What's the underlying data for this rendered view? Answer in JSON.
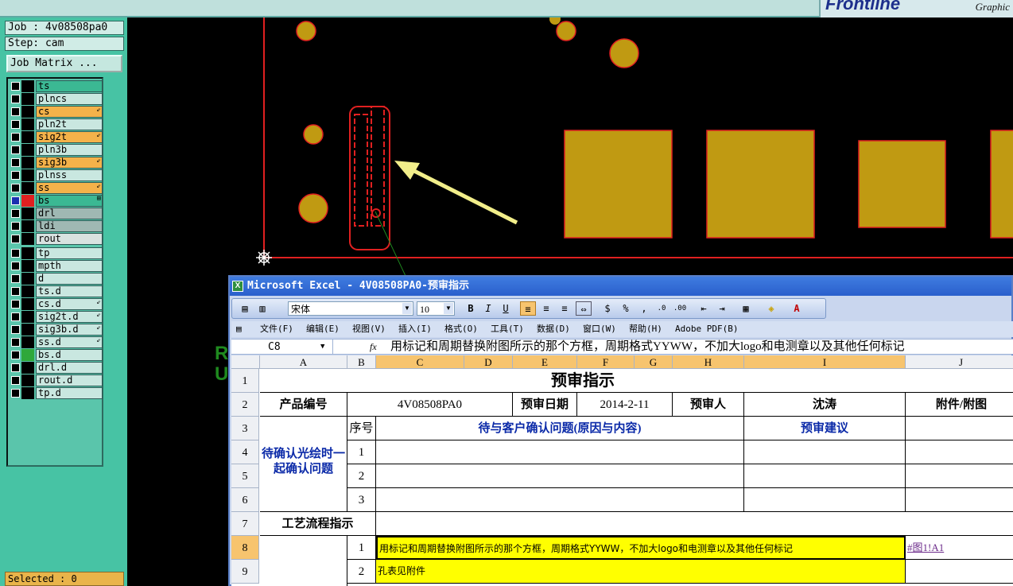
{
  "cam": {
    "job": "Job : 4v08508pa0",
    "step": "Step: cam",
    "job_matrix": "Job Matrix ...",
    "selected": "Selected : 0",
    "layers": [
      {
        "name": "ts",
        "color": "#3bb893",
        "mark": ""
      },
      {
        "name": "plncs",
        "color": "#c9e7e0",
        "mark": ""
      },
      {
        "name": "cs",
        "color": "#f4b24a",
        "mark": "⇙"
      },
      {
        "name": "pln2t",
        "color": "#c9e7e0",
        "mark": ""
      },
      {
        "name": "sig2t",
        "color": "#f4b24a",
        "mark": "⇙"
      },
      {
        "name": "pln3b",
        "color": "#c9e7e0",
        "mark": ""
      },
      {
        "name": "sig3b",
        "color": "#f4b24a",
        "mark": "⇙"
      },
      {
        "name": "plnss",
        "color": "#c9e7e0",
        "mark": ""
      },
      {
        "name": "ss",
        "color": "#f4b24a",
        "mark": "⇙"
      },
      {
        "name": "bs",
        "color": "#3bb893",
        "mark": "⊞"
      },
      {
        "name": "drl",
        "color": "#9fb8b3",
        "mark": ""
      },
      {
        "name": "ldi",
        "color": "#9fb8b3",
        "mark": ""
      },
      {
        "name": "rout",
        "color": "#d8e2e0",
        "mark": ""
      },
      {
        "name": "tp",
        "color": "#c9e7e0",
        "mark": ""
      },
      {
        "name": "mpth",
        "color": "#c9e7e0",
        "mark": ""
      },
      {
        "name": "d",
        "color": "#c9e7e0",
        "mark": ""
      },
      {
        "name": "ts.d",
        "color": "#c9e7e0",
        "mark": ""
      },
      {
        "name": "cs.d",
        "color": "#c9e7e0",
        "mark": "⇙"
      },
      {
        "name": "sig2t.d",
        "color": "#c9e7e0",
        "mark": "⇙"
      },
      {
        "name": "sig3b.d",
        "color": "#c9e7e0",
        "mark": "⇙"
      },
      {
        "name": "ss.d",
        "color": "#c9e7e0",
        "mark": "⇙"
      },
      {
        "name": "bs.d",
        "color": "#c9e7e0",
        "mark": ""
      },
      {
        "name": "drl.d",
        "color": "#c9e7e0",
        "mark": ""
      },
      {
        "name": "rout.d",
        "color": "#c9e7e0",
        "mark": ""
      },
      {
        "name": "tp.d",
        "color": "#c9e7e0",
        "mark": ""
      }
    ],
    "brand_sub": "Graphic",
    "side_letters": "R\nU"
  },
  "excel": {
    "title": "Microsoft Excel - 4V08508PA0-预审指示",
    "font_name": "宋体",
    "font_size": "10",
    "menus": [
      "文件(F)",
      "编辑(E)",
      "视图(V)",
      "插入(I)",
      "格式(O)",
      "工具(T)",
      "数据(D)",
      "窗口(W)",
      "帮助(H)",
      "Adobe PDF(B)"
    ],
    "name_box": "C8",
    "fx": "fx",
    "formula": "用标记和周期替换附图所示的那个方框，周期格式YYWW，不加大logo和电测章以及其他任何标记",
    "columns": [
      "A",
      "B",
      "C",
      "D",
      "E",
      "F",
      "G",
      "H",
      "I",
      "J"
    ],
    "rows": [
      "1",
      "2",
      "3",
      "4",
      "5",
      "6",
      "7",
      "8",
      "9"
    ],
    "cells": {
      "title": "预审指示",
      "product_label": "产品编号",
      "product_value": "4V08508PA0",
      "date_label": "预审日期",
      "date_value": "2014-2-11",
      "reviewer_label": "预审人",
      "reviewer_value": "沈涛",
      "attach_label": "附件/附图",
      "seq_label": "序号",
      "issue_header": "待与客户确认问题(原因与内容)",
      "advice_header": "预审建议",
      "confirm_label": "待确认光绘时一起确认问题",
      "n1": "1",
      "n2": "2",
      "n3": "3",
      "process_label": "工艺流程指示",
      "p1": "1",
      "p2": "2",
      "instr1": "用标记和周期替换附图所示的那个方框，周期格式YYWW，不加大logo和电测章以及其他任何标记",
      "instr2": "孔表见附件",
      "link1": "#图1!A1"
    }
  }
}
